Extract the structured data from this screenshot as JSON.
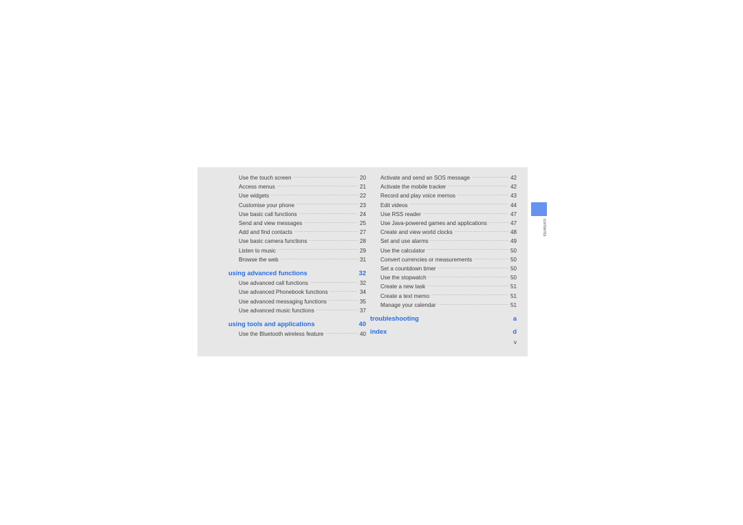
{
  "document": {
    "folio": "v",
    "side_tab": {
      "label": "contents",
      "swatch_color": "#6593ef"
    },
    "colors": {
      "page_background": "#e7e7e7",
      "canvas_background": "#ffffff",
      "heading_blue": "#2a6de0",
      "body_text": "#3c3c3c",
      "leader_dots": "#9a9a9a"
    }
  },
  "columns": {
    "left": [
      {
        "type": "entry",
        "label": "Use the touch screen",
        "page": "20"
      },
      {
        "type": "entry",
        "label": "Access menus",
        "page": "21"
      },
      {
        "type": "entry",
        "label": "Use widgets",
        "page": "22"
      },
      {
        "type": "entry",
        "label": "Customise your phone",
        "page": "23"
      },
      {
        "type": "entry",
        "label": "Use basic call functions",
        "page": "24"
      },
      {
        "type": "entry",
        "label": "Send and view messages",
        "page": "25"
      },
      {
        "type": "entry",
        "label": "Add and find contacts",
        "page": "27"
      },
      {
        "type": "entry",
        "label": "Use basic camera functions",
        "page": "28"
      },
      {
        "type": "entry",
        "label": "Listen to music",
        "page": "29"
      },
      {
        "type": "entry",
        "label": "Browse the web",
        "page": "31"
      },
      {
        "type": "heading",
        "label": "using advanced functions",
        "page": "32"
      },
      {
        "type": "entry",
        "label": "Use advanced call functions",
        "page": "32"
      },
      {
        "type": "entry",
        "label": "Use advanced Phonebook functions",
        "page": "34"
      },
      {
        "type": "entry",
        "label": "Use advanced messaging functions",
        "page": "35"
      },
      {
        "type": "entry",
        "label": "Use advanced music functions",
        "page": "37"
      },
      {
        "type": "heading",
        "label": "using tools and applications",
        "page": "40"
      },
      {
        "type": "entry",
        "label": "Use the Bluetooth wireless feature",
        "page": "40"
      }
    ],
    "right": [
      {
        "type": "entry",
        "label": "Activate and send an SOS message",
        "page": "42"
      },
      {
        "type": "entry",
        "label": "Activate the mobile tracker",
        "page": "42"
      },
      {
        "type": "entry",
        "label": "Record and play voice memos",
        "page": "43"
      },
      {
        "type": "entry",
        "label": "Edit videos",
        "page": "44"
      },
      {
        "type": "entry",
        "label": "Use RSS reader",
        "page": "47"
      },
      {
        "type": "entry",
        "label": "Use Java-powered games and applications",
        "page": "47"
      },
      {
        "type": "entry",
        "label": "Create and view world clocks",
        "page": "48"
      },
      {
        "type": "entry",
        "label": "Set and use alarms",
        "page": "49"
      },
      {
        "type": "entry",
        "label": "Use the calculator",
        "page": "50"
      },
      {
        "type": "entry",
        "label": "Convert currencies or measurements",
        "page": "50"
      },
      {
        "type": "entry",
        "label": "Set a countdown timer",
        "page": "50"
      },
      {
        "type": "entry",
        "label": "Use the stopwatch",
        "page": "50"
      },
      {
        "type": "entry",
        "label": "Create a new task",
        "page": "51"
      },
      {
        "type": "entry",
        "label": "Create a text memo",
        "page": "51"
      },
      {
        "type": "entry",
        "label": "Manage your calendar",
        "page": "51"
      },
      {
        "type": "heading",
        "label": "troubleshooting",
        "page": "a"
      },
      {
        "type": "heading",
        "label": "index",
        "page": "d"
      }
    ]
  }
}
